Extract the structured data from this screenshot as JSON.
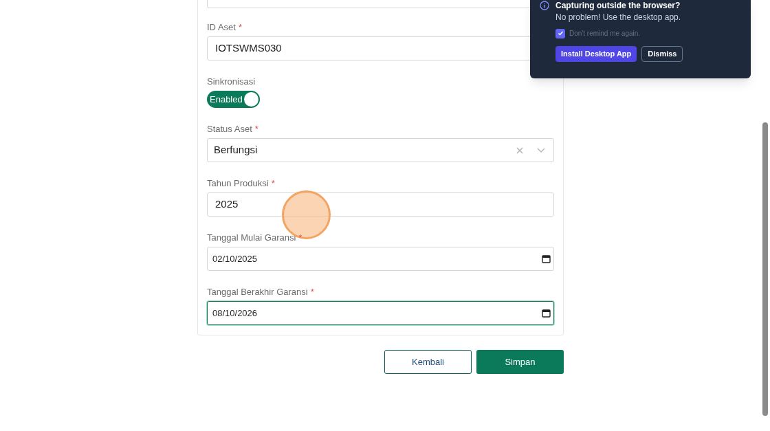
{
  "form": {
    "fields": [
      {
        "kind": "text",
        "label": "ID Aset",
        "required": true,
        "value": "IOTSWMS030",
        "focused": false
      },
      {
        "kind": "toggle",
        "label": "Sinkronisasi",
        "required": false,
        "on": true,
        "toggle_text": "Enabled"
      },
      {
        "kind": "select",
        "label": "Status Aset",
        "required": true,
        "value": "Berfungsi"
      },
      {
        "kind": "text",
        "label": "Tahun Produksi",
        "required": true,
        "value": "2025",
        "focused": false
      },
      {
        "kind": "date",
        "label": "Tanggal Mulai Garansi",
        "required": true,
        "value": "02/10/2025",
        "focused": false
      },
      {
        "kind": "date",
        "label": "Tanggal Berakhir Garansi",
        "required": true,
        "value": "08/10/2026",
        "focused": true
      }
    ]
  },
  "required_mark": "*",
  "buttons": [
    {
      "kind": "secondary",
      "label": "Kembali"
    },
    {
      "kind": "primary",
      "label": "Simpan"
    }
  ],
  "notice": {
    "title": "Capturing outside the browser?",
    "message": "No problem! Use the desktop app.",
    "checkbox": {
      "label": "Don't remind me again.",
      "checked": true
    },
    "buttons": [
      {
        "kind": "primary",
        "label": "Install Desktop App"
      },
      {
        "kind": "secondary",
        "label": "Dismiss"
      }
    ]
  }
}
